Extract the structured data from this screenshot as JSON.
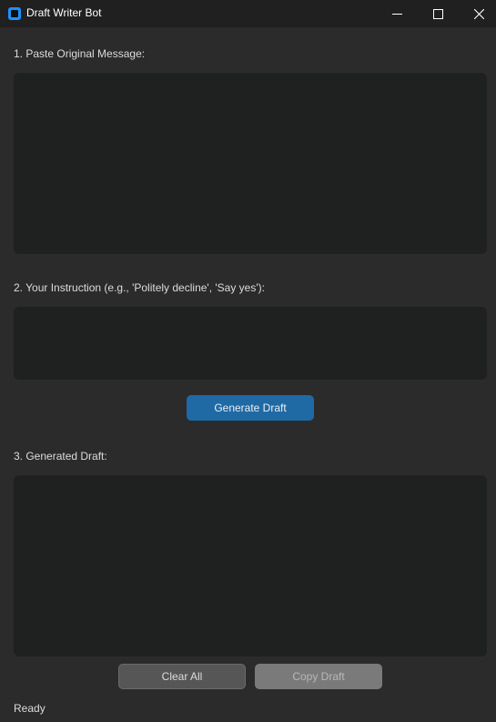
{
  "window": {
    "title": "Draft Writer Bot",
    "icon": "app-icon",
    "controls": {
      "minimize_icon": "minimize-icon",
      "maximize_icon": "maximize-icon",
      "close_icon": "close-icon"
    }
  },
  "sections": {
    "original": {
      "label": "1. Paste Original Message:",
      "value": ""
    },
    "instruction": {
      "label": "2. Your Instruction (e.g., 'Politely decline', 'Say yes'):",
      "value": ""
    },
    "draft": {
      "label": "3. Generated Draft:",
      "value": ""
    }
  },
  "buttons": {
    "generate": "Generate Draft",
    "clear": "Clear All",
    "copy": "Copy Draft"
  },
  "status": "Ready",
  "colors": {
    "background": "#2b2b2b",
    "titlebar": "#202020",
    "textbox": "#1f2020",
    "accent": "#1f6aa5",
    "button_secondary": "#565656",
    "button_disabled": "#7a7a7a"
  }
}
